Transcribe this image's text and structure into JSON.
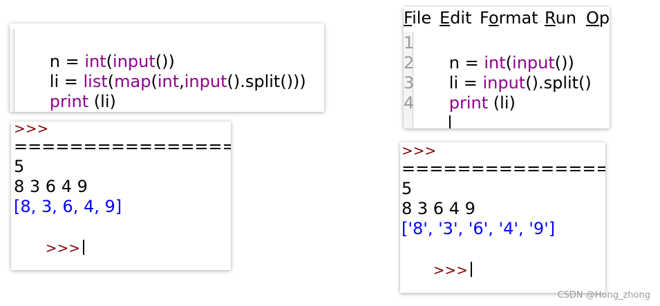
{
  "left_editor": {
    "partial_top": "'",
    "lines": [
      "n = int(input())",
      "li = list(map(int,input().split()))",
      "print (li)"
    ]
  },
  "left_shell": {
    "prompt": ">>>",
    "restart_partial": "================ RES",
    "input_n": "5",
    "input_values": "8 3 6 4 9",
    "output": "[8, 3, 6, 4, 9]",
    "prompt_last": ">>>"
  },
  "right_editor": {
    "menu": [
      "File",
      "Edit",
      "Format",
      "Run",
      "Op"
    ],
    "line_numbers": [
      "1",
      "2",
      "3",
      "4"
    ],
    "lines": [
      "n = int(input())",
      "li = input().split()",
      "print (li)"
    ]
  },
  "right_shell": {
    "prompt": ">>>",
    "restart_partial": "================ RE",
    "input_n": "5",
    "input_values": "8 3 6 4 9",
    "output": "['8', '3', '6', '4', '9']",
    "prompt_last": ">>>"
  },
  "watermark": "CSDN @Hong_zhong",
  "colors": {
    "keyword": "#900090",
    "prompt": "#7f0000",
    "output": "#0000ff"
  }
}
